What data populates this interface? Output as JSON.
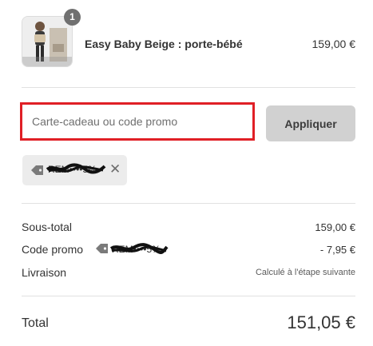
{
  "cart_item": {
    "quantity": "1",
    "name": "Easy Baby Beige : porte-bébé",
    "price": "159,00 €",
    "image_alt": "product-photo"
  },
  "promo": {
    "placeholder": "Carte-cadeau ou code promo",
    "value": "",
    "apply_label": "Appliquer",
    "highlight_color": "#e01f26"
  },
  "applied_code": {
    "code": "REM••••5%",
    "remove_symbol": "✕"
  },
  "summary": {
    "subtotal_label": "Sous-total",
    "subtotal_value": "159,00 €",
    "promo_label": "Code promo",
    "promo_code": "REM••••5%",
    "promo_value": "- 7,95 €",
    "shipping_label": "Livraison",
    "shipping_value": "Calculé à l'étape suivante",
    "total_label": "Total",
    "total_value": "151,05 €"
  }
}
